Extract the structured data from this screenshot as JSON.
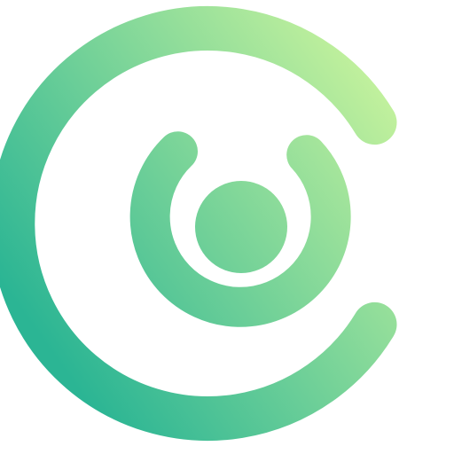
{
  "logo": {
    "icon_name": "concentric-c-logo-icon",
    "gradient": {
      "start_color": "#2bb594",
      "end_color": "#c3f19d"
    }
  }
}
